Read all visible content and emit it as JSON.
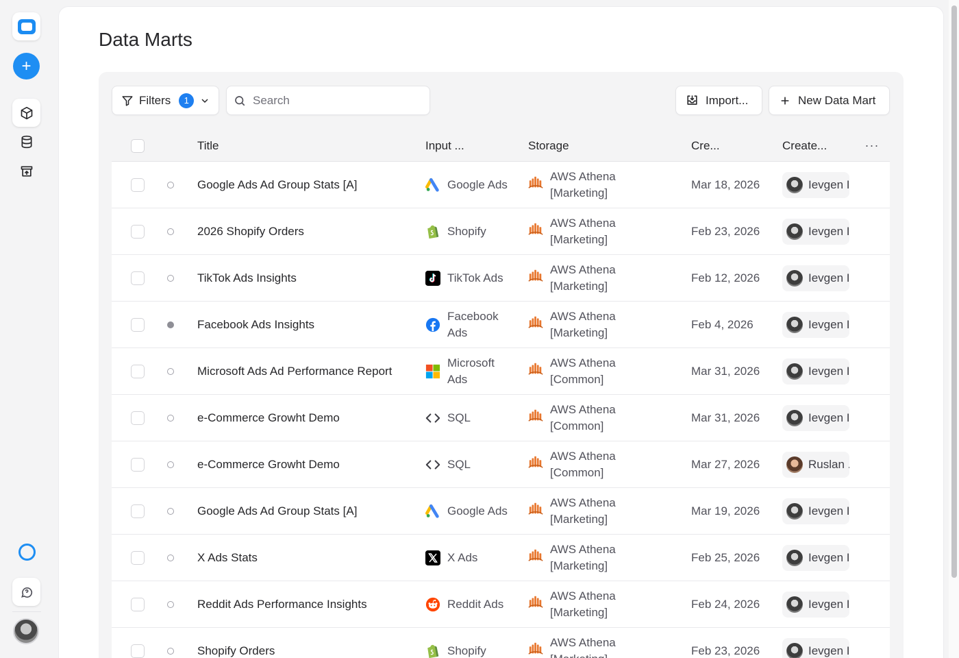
{
  "page": {
    "title": "Data Marts"
  },
  "toolbar": {
    "filters_label": "Filters",
    "filters_count": "1",
    "search_placeholder": "Search",
    "import_label": "Import...",
    "new_label": "New Data Mart"
  },
  "table": {
    "headers": {
      "title": "Title",
      "input": "Input ...",
      "storage": "Storage",
      "created": "Cre...",
      "creator": "Create...",
      "more": "···"
    },
    "rows": [
      {
        "title": "Google Ads Ad Group Stats [A]",
        "input": "Google Ads",
        "input_icon": "google-ads",
        "storage_line1": "AWS Athena",
        "storage_line2": "[Marketing]",
        "created": "Mar 18, 2026",
        "creator": "Ievgen I",
        "creator_avatar": "ievgen",
        "status": "draft"
      },
      {
        "title": "2026 Shopify Orders",
        "input": "Shopify",
        "input_icon": "shopify",
        "storage_line1": "AWS Athena",
        "storage_line2": "[Marketing]",
        "created": "Feb 23, 2026",
        "creator": "Ievgen I",
        "creator_avatar": "ievgen",
        "status": "draft"
      },
      {
        "title": "TikTok Ads Insights",
        "input": "TikTok Ads",
        "input_icon": "tiktok",
        "storage_line1": "AWS Athena",
        "storage_line2": "[Marketing]",
        "created": "Feb 12, 2026",
        "creator": "Ievgen I",
        "creator_avatar": "ievgen",
        "status": "draft"
      },
      {
        "title": "Facebook Ads Insights",
        "input": "Facebook Ads",
        "input_icon": "facebook",
        "storage_line1": "AWS Athena",
        "storage_line2": "[Marketing]",
        "created": "Feb 4, 2026",
        "creator": "Ievgen I",
        "creator_avatar": "ievgen",
        "status": "published"
      },
      {
        "title": "Microsoft Ads Ad Performance Report",
        "input": "Microsoft Ads",
        "input_icon": "microsoft",
        "storage_line1": "AWS Athena",
        "storage_line2": "[Common]",
        "created": "Mar 31, 2026",
        "creator": "Ievgen I",
        "creator_avatar": "ievgen",
        "status": "draft"
      },
      {
        "title": "e-Commerce Growht Demo",
        "input": "SQL",
        "input_icon": "sql",
        "storage_line1": "AWS Athena",
        "storage_line2": "[Common]",
        "created": "Mar 31, 2026",
        "creator": "Ievgen I",
        "creator_avatar": "ievgen",
        "status": "draft"
      },
      {
        "title": "e-Commerce Growht Demo",
        "input": "SQL",
        "input_icon": "sql",
        "storage_line1": "AWS Athena",
        "storage_line2": "[Common]",
        "created": "Mar 27, 2026",
        "creator": "Ruslan .",
        "creator_avatar": "ruslan",
        "status": "draft"
      },
      {
        "title": "Google Ads Ad Group Stats [A]",
        "input": "Google Ads",
        "input_icon": "google-ads",
        "storage_line1": "AWS Athena",
        "storage_line2": "[Marketing]",
        "created": "Mar 19, 2026",
        "creator": "Ievgen I",
        "creator_avatar": "ievgen",
        "status": "draft"
      },
      {
        "title": "X Ads Stats",
        "input": "X Ads",
        "input_icon": "x",
        "storage_line1": "AWS Athena",
        "storage_line2": "[Marketing]",
        "created": "Feb 25, 2026",
        "creator": "Ievgen I",
        "creator_avatar": "ievgen",
        "status": "draft"
      },
      {
        "title": "Reddit Ads Performance Insights",
        "input": "Reddit Ads",
        "input_icon": "reddit",
        "storage_line1": "AWS Athena",
        "storage_line2": "[Marketing]",
        "created": "Feb 24, 2026",
        "creator": "Ievgen I",
        "creator_avatar": "ievgen",
        "status": "draft"
      },
      {
        "title": "Shopify Orders",
        "input": "Shopify",
        "input_icon": "shopify",
        "storage_line1": "AWS Athena",
        "storage_line2": "[Marketing]",
        "created": "Feb 23, 2026",
        "creator": "Ievgen I",
        "creator_avatar": "ievgen",
        "status": "draft"
      }
    ]
  },
  "colors": {
    "accent": "#1e8ef3",
    "badge": "#1e7ff0",
    "athena": "#e8772e"
  }
}
